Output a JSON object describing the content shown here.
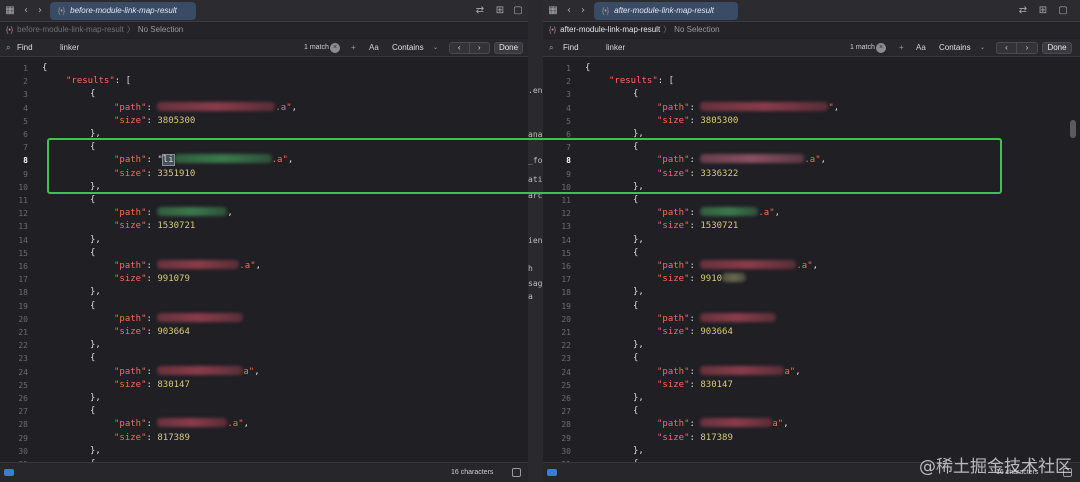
{
  "panes": [
    {
      "id": "left",
      "tab_title": "before-module-link-map-result",
      "tab_icon": "{•}",
      "jump_file": "before-module-link-map-result",
      "jump_selection": "No Selection",
      "find_label": "Find",
      "find_query": "linker",
      "match_count": "1 match",
      "option_case": "Aa",
      "option_mode": "Contains",
      "done_label": "Done",
      "status_chars": "16 characters",
      "current_line": 8,
      "lines": [
        {
          "n": 1,
          "indent": 0,
          "tokens": [
            {
              "t": "{",
              "c": "p"
            }
          ]
        },
        {
          "n": 2,
          "indent": 1,
          "tokens": [
            {
              "t": "\"results\"",
              "c": "k"
            },
            {
              "t": ": [",
              "c": "p"
            }
          ]
        },
        {
          "n": 3,
          "indent": 2,
          "tokens": [
            {
              "t": "{",
              "c": "p"
            }
          ]
        },
        {
          "n": 4,
          "indent": 3,
          "tokens": [
            {
              "t": "\"path\"",
              "c": "k"
            },
            {
              "t": ": ",
              "c": "p"
            },
            {
              "blur": 118,
              "color": "#8a3c4a"
            },
            {
              "t": ".a\"",
              "c": "s"
            },
            {
              "t": ",",
              "c": "p"
            }
          ]
        },
        {
          "n": 5,
          "indent": 3,
          "tokens": [
            {
              "t": "\"size\"",
              "c": "k"
            },
            {
              "t": ": ",
              "c": "p"
            },
            {
              "t": "3805300",
              "c": "n"
            }
          ]
        },
        {
          "n": 6,
          "indent": 2,
          "tokens": [
            {
              "t": "},",
              "c": "p"
            }
          ]
        },
        {
          "n": 7,
          "indent": 2,
          "tokens": [
            {
              "t": "{",
              "c": "p"
            }
          ]
        },
        {
          "n": 8,
          "indent": 3,
          "tokens": [
            {
              "t": "\"path\"",
              "c": "k"
            },
            {
              "t": ": \"",
              "c": "p"
            },
            {
              "t": "li",
              "c": "p",
              "sel": true
            },
            {
              "blur": 98,
              "color": "#3b7a4c"
            },
            {
              "t": ".a\"",
              "c": "s"
            },
            {
              "t": ",",
              "c": "p"
            }
          ]
        },
        {
          "n": 9,
          "indent": 3,
          "tokens": [
            {
              "t": "\"size\"",
              "c": "k"
            },
            {
              "t": ": ",
              "c": "p"
            },
            {
              "t": "3351910",
              "c": "n"
            }
          ]
        },
        {
          "n": 10,
          "indent": 2,
          "tokens": [
            {
              "t": "},",
              "c": "p"
            }
          ]
        },
        {
          "n": 11,
          "indent": 2,
          "tokens": [
            {
              "t": "{",
              "c": "p"
            }
          ]
        },
        {
          "n": 12,
          "indent": 3,
          "tokens": [
            {
              "t": "\"path\"",
              "c": "k"
            },
            {
              "t": ": ",
              "c": "p"
            },
            {
              "blur": 70,
              "color": "#3b7a4c"
            },
            {
              "t": ",",
              "c": "p"
            }
          ]
        },
        {
          "n": 13,
          "indent": 3,
          "tokens": [
            {
              "t": "\"size\"",
              "c": "k"
            },
            {
              "t": ": ",
              "c": "p"
            },
            {
              "t": "1530721",
              "c": "n"
            }
          ]
        },
        {
          "n": 14,
          "indent": 2,
          "tokens": [
            {
              "t": "},",
              "c": "p"
            }
          ]
        },
        {
          "n": 15,
          "indent": 2,
          "tokens": [
            {
              "t": "{",
              "c": "p"
            }
          ]
        },
        {
          "n": 16,
          "indent": 3,
          "tokens": [
            {
              "t": "\"path\"",
              "c": "k"
            },
            {
              "t": ": ",
              "c": "p"
            },
            {
              "blur": 82,
              "color": "#8a3c4a"
            },
            {
              "t": ".a\"",
              "c": "s"
            },
            {
              "t": ",",
              "c": "p"
            }
          ]
        },
        {
          "n": 17,
          "indent": 3,
          "tokens": [
            {
              "t": "\"size\"",
              "c": "k"
            },
            {
              "t": ": ",
              "c": "p"
            },
            {
              "t": "991079",
              "c": "n"
            }
          ]
        },
        {
          "n": 18,
          "indent": 2,
          "tokens": [
            {
              "t": "},",
              "c": "p"
            }
          ]
        },
        {
          "n": 19,
          "indent": 2,
          "tokens": [
            {
              "t": "{",
              "c": "p"
            }
          ]
        },
        {
          "n": 20,
          "indent": 3,
          "tokens": [
            {
              "t": "\"path\"",
              "c": "k"
            },
            {
              "t": ": ",
              "c": "p"
            },
            {
              "blur": 86,
              "color": "#8a3c4a"
            }
          ]
        },
        {
          "n": 21,
          "indent": 3,
          "tokens": [
            {
              "t": "\"size\"",
              "c": "k"
            },
            {
              "t": ": ",
              "c": "p"
            },
            {
              "t": "903664",
              "c": "n"
            }
          ]
        },
        {
          "n": 22,
          "indent": 2,
          "tokens": [
            {
              "t": "},",
              "c": "p"
            }
          ]
        },
        {
          "n": 23,
          "indent": 2,
          "tokens": [
            {
              "t": "{",
              "c": "p"
            }
          ]
        },
        {
          "n": 24,
          "indent": 3,
          "tokens": [
            {
              "t": "\"path\"",
              "c": "k"
            },
            {
              "t": ": ",
              "c": "p"
            },
            {
              "blur": 86,
              "color": "#8a3c4a"
            },
            {
              "t": "a\"",
              "c": "s"
            },
            {
              "t": ",",
              "c": "p"
            }
          ]
        },
        {
          "n": 25,
          "indent": 3,
          "tokens": [
            {
              "t": "\"size\"",
              "c": "k"
            },
            {
              "t": ": ",
              "c": "p"
            },
            {
              "t": "830147",
              "c": "n"
            }
          ]
        },
        {
          "n": 26,
          "indent": 2,
          "tokens": [
            {
              "t": "},",
              "c": "p"
            }
          ]
        },
        {
          "n": 27,
          "indent": 2,
          "tokens": [
            {
              "t": "{",
              "c": "p"
            }
          ]
        },
        {
          "n": 28,
          "indent": 3,
          "tokens": [
            {
              "t": "\"path\"",
              "c": "k"
            },
            {
              "t": ": ",
              "c": "p"
            },
            {
              "blur": 70,
              "color": "#8a3c4a"
            },
            {
              "t": ".a\"",
              "c": "s"
            },
            {
              "t": ",",
              "c": "p"
            }
          ]
        },
        {
          "n": 29,
          "indent": 3,
          "tokens": [
            {
              "t": "\"size\"",
              "c": "k"
            },
            {
              "t": ": ",
              "c": "p"
            },
            {
              "t": "817389",
              "c": "n"
            }
          ]
        },
        {
          "n": 30,
          "indent": 2,
          "tokens": [
            {
              "t": "},",
              "c": "p"
            }
          ]
        },
        {
          "n": 31,
          "indent": 2,
          "tokens": [
            {
              "t": "{",
              "c": "p"
            }
          ]
        }
      ]
    },
    {
      "id": "right",
      "tab_title": "after-module-link-map-result",
      "tab_icon": "{•}",
      "jump_file": "after-module-link-map-result",
      "jump_selection": "No Selection",
      "find_label": "Find",
      "find_query": "linker",
      "match_count": "1 match",
      "option_case": "Aa",
      "option_mode": "Contains",
      "done_label": "Done",
      "status_chars": "16 characters",
      "current_line": 8,
      "lines": [
        {
          "n": 1,
          "indent": 0,
          "tokens": [
            {
              "t": "{",
              "c": "p"
            }
          ]
        },
        {
          "n": 2,
          "indent": 1,
          "tokens": [
            {
              "t": "\"results\"",
              "c": "k"
            },
            {
              "t": ": [",
              "c": "p"
            }
          ]
        },
        {
          "n": 3,
          "indent": 2,
          "tokens": [
            {
              "t": "{",
              "c": "p"
            }
          ]
        },
        {
          "n": 4,
          "indent": 3,
          "tokens": [
            {
              "t": "\"path\"",
              "c": "k"
            },
            {
              "t": ": ",
              "c": "p"
            },
            {
              "blur": 128,
              "color": "#8a3c4a"
            },
            {
              "t": "\"",
              "c": "s"
            },
            {
              "t": ",",
              "c": "p"
            }
          ]
        },
        {
          "n": 5,
          "indent": 3,
          "tokens": [
            {
              "t": "\"size\"",
              "c": "k"
            },
            {
              "t": ": ",
              "c": "p"
            },
            {
              "t": "3805300",
              "c": "n"
            }
          ]
        },
        {
          "n": 6,
          "indent": 2,
          "tokens": [
            {
              "t": "},",
              "c": "p"
            }
          ]
        },
        {
          "n": 7,
          "indent": 2,
          "tokens": [
            {
              "t": "{",
              "c": "p"
            }
          ]
        },
        {
          "n": 8,
          "indent": 3,
          "tokens": [
            {
              "t": "\"path\"",
              "c": "k"
            },
            {
              "t": ": ",
              "c": "p"
            },
            {
              "blur": 104,
              "color": "#8a5060"
            },
            {
              "t": ".a\"",
              "c": "s"
            },
            {
              "t": ",",
              "c": "p"
            }
          ]
        },
        {
          "n": 9,
          "indent": 3,
          "tokens": [
            {
              "t": "\"size\"",
              "c": "k"
            },
            {
              "t": ": ",
              "c": "p"
            },
            {
              "t": "3336322",
              "c": "n"
            }
          ]
        },
        {
          "n": 10,
          "indent": 2,
          "tokens": [
            {
              "t": "},",
              "c": "p"
            }
          ]
        },
        {
          "n": 11,
          "indent": 2,
          "tokens": [
            {
              "t": "{",
              "c": "p"
            }
          ]
        },
        {
          "n": 12,
          "indent": 3,
          "tokens": [
            {
              "t": "\"path\"",
              "c": "k"
            },
            {
              "t": ": ",
              "c": "p"
            },
            {
              "blur": 58,
              "color": "#3b7a4c"
            },
            {
              "t": ".a\"",
              "c": "s"
            },
            {
              "t": ",",
              "c": "p"
            }
          ]
        },
        {
          "n": 13,
          "indent": 3,
          "tokens": [
            {
              "t": "\"size\"",
              "c": "k"
            },
            {
              "t": ": ",
              "c": "p"
            },
            {
              "t": "1530721",
              "c": "n"
            }
          ]
        },
        {
          "n": 14,
          "indent": 2,
          "tokens": [
            {
              "t": "},",
              "c": "p"
            }
          ]
        },
        {
          "n": 15,
          "indent": 2,
          "tokens": [
            {
              "t": "{",
              "c": "p"
            }
          ]
        },
        {
          "n": 16,
          "indent": 3,
          "tokens": [
            {
              "t": "\"path\"",
              "c": "k"
            },
            {
              "t": ": ",
              "c": "p"
            },
            {
              "blur": 96,
              "color": "#8a3c4a"
            },
            {
              "t": ".a\"",
              "c": "s"
            },
            {
              "t": ",",
              "c": "p"
            }
          ]
        },
        {
          "n": 17,
          "indent": 3,
          "tokens": [
            {
              "t": "\"size\"",
              "c": "k"
            },
            {
              "t": ": ",
              "c": "p"
            },
            {
              "t": "9910",
              "c": "n"
            },
            {
              "blur": 24,
              "color": "#6a6a50"
            }
          ]
        },
        {
          "n": 18,
          "indent": 2,
          "tokens": [
            {
              "t": "},",
              "c": "p"
            }
          ]
        },
        {
          "n": 19,
          "indent": 2,
          "tokens": [
            {
              "t": "{",
              "c": "p"
            }
          ]
        },
        {
          "n": 20,
          "indent": 3,
          "tokens": [
            {
              "t": "\"path\"",
              "c": "k"
            },
            {
              "t": ": ",
              "c": "p"
            },
            {
              "blur": 76,
              "color": "#8a3c4a"
            }
          ]
        },
        {
          "n": 21,
          "indent": 3,
          "tokens": [
            {
              "t": "\"size\"",
              "c": "k"
            },
            {
              "t": ": ",
              "c": "p"
            },
            {
              "t": "903664",
              "c": "n"
            }
          ]
        },
        {
          "n": 22,
          "indent": 2,
          "tokens": [
            {
              "t": "},",
              "c": "p"
            }
          ]
        },
        {
          "n": 23,
          "indent": 2,
          "tokens": [
            {
              "t": "{",
              "c": "p"
            }
          ]
        },
        {
          "n": 24,
          "indent": 3,
          "tokens": [
            {
              "t": "\"path\"",
              "c": "k"
            },
            {
              "t": ": ",
              "c": "p"
            },
            {
              "blur": 84,
              "color": "#8a3c4a"
            },
            {
              "t": "a\"",
              "c": "s"
            },
            {
              "t": ",",
              "c": "p"
            }
          ]
        },
        {
          "n": 25,
          "indent": 3,
          "tokens": [
            {
              "t": "\"size\"",
              "c": "k"
            },
            {
              "t": ": ",
              "c": "p"
            },
            {
              "t": "830147",
              "c": "n"
            }
          ]
        },
        {
          "n": 26,
          "indent": 2,
          "tokens": [
            {
              "t": "},",
              "c": "p"
            }
          ]
        },
        {
          "n": 27,
          "indent": 2,
          "tokens": [
            {
              "t": "{",
              "c": "p"
            }
          ]
        },
        {
          "n": 28,
          "indent": 3,
          "tokens": [
            {
              "t": "\"path\"",
              "c": "k"
            },
            {
              "t": ": ",
              "c": "p"
            },
            {
              "blur": 72,
              "color": "#8a3c4a"
            },
            {
              "t": "a\"",
              "c": "s"
            },
            {
              "t": ",",
              "c": "p"
            }
          ]
        },
        {
          "n": 29,
          "indent": 3,
          "tokens": [
            {
              "t": "\"size\"",
              "c": "k"
            },
            {
              "t": ": ",
              "c": "p"
            },
            {
              "t": "817389",
              "c": "n"
            }
          ]
        },
        {
          "n": 30,
          "indent": 2,
          "tokens": [
            {
              "t": "},",
              "c": "p"
            }
          ]
        },
        {
          "n": 31,
          "indent": 2,
          "tokens": [
            {
              "t": "{",
              "c": "p"
            }
          ]
        }
      ]
    }
  ],
  "gap_fragments": [
    ".en",
    "ana",
    "_fo",
    "atic",
    "arc",
    "ienc",
    "h",
    "sag",
    "a"
  ],
  "watermark": "@稀土掘金技术社区",
  "colors": {
    "highlight_box": "#3fc24f",
    "tab_active": "#3a4b66",
    "json_key": "#fc6a5d",
    "json_number": "#d9c97c"
  },
  "icons": {
    "grid": "grid-icon",
    "back": "chevron-left-icon",
    "forward": "chevron-right-icon",
    "swap": "split-compare-icon",
    "add_editor": "add-editor-icon"
  }
}
